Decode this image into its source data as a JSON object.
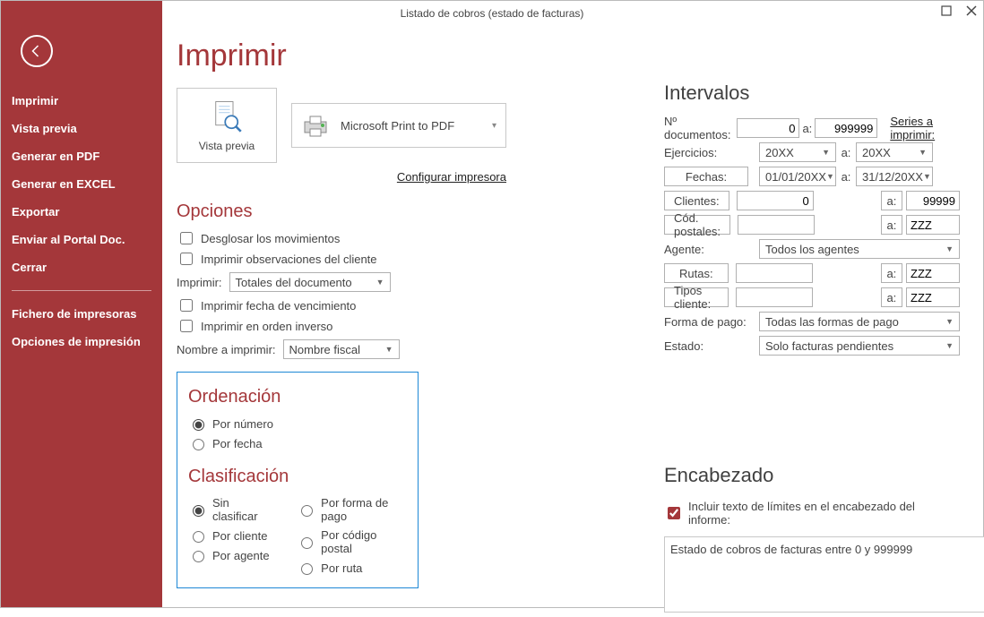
{
  "titlebar": "Listado de cobros (estado de facturas)",
  "sidebar": {
    "items": [
      {
        "label": "Imprimir",
        "bold": true
      },
      {
        "label": "Vista previa",
        "bold": true
      },
      {
        "label": "Generar en PDF",
        "bold": true
      },
      {
        "label": "Generar en EXCEL",
        "bold": true
      },
      {
        "label": "Exportar",
        "bold": true
      },
      {
        "label": "Enviar al Portal Doc.",
        "bold": true
      },
      {
        "label": "Cerrar",
        "bold": true
      }
    ],
    "items2": [
      {
        "label": "Fichero de impresoras",
        "bold": true
      },
      {
        "label": "Opciones de impresión",
        "bold": true
      }
    ]
  },
  "page_title": "Imprimir",
  "preview_label": "Vista previa",
  "printer_name": "Microsoft Print to PDF",
  "configure_printer": "Configurar impresora",
  "sections": {
    "options": "Opciones",
    "order": "Ordenación",
    "classif": "Clasificación",
    "intervals": "Intervalos",
    "header": "Encabezado"
  },
  "options": {
    "desglosar": "Desglosar los movimientos",
    "imprimir_obs": "Imprimir observaciones del cliente",
    "imprimir_label": "Imprimir:",
    "imprimir_value": "Totales del documento",
    "imp_venc": "Imprimir fecha de vencimiento",
    "imp_inv": "Imprimir en orden inverso",
    "nombre_label": "Nombre a imprimir:",
    "nombre_value": "Nombre fiscal"
  },
  "order": {
    "r1": "Por número",
    "r2": "Por fecha"
  },
  "classif": {
    "r1": "Sin clasificar",
    "r2": "Por cliente",
    "r3": "Por agente",
    "r4": "Por forma de pago",
    "r5": "Por código postal",
    "r6": "Por ruta"
  },
  "intervals": {
    "ndoc": "Nº documentos:",
    "ndoc_from": "0",
    "ndoc_to": "999999",
    "series": "Series a imprimir:",
    "ejer": "Ejercicios:",
    "ejer_from": "20XX",
    "ejer_to": "20XX",
    "fechas": "Fechas:",
    "fecha_from": "01/01/20XX",
    "fecha_to": "31/12/20XX",
    "clientes": "Clientes:",
    "cli_from": "0",
    "cli_to": "99999",
    "cp": "Cód. postales:",
    "cp_from": "",
    "cp_to": "ZZZ",
    "agente": "Agente:",
    "agente_val": "Todos los agentes",
    "rutas": "Rutas:",
    "ruta_from": "",
    "ruta_to": "ZZZ",
    "tipos": "Tipos cliente:",
    "tipo_from": "",
    "tipo_to": "ZZZ",
    "forma": "Forma de pago:",
    "forma_val": "Todas las formas de pago",
    "estado": "Estado:",
    "estado_val": "Solo facturas pendientes",
    "a": "a:"
  },
  "header": {
    "chk": "Incluir texto de límites en el encabezado del informe:",
    "text": "Estado de cobros de facturas entre 0 y 999999"
  }
}
